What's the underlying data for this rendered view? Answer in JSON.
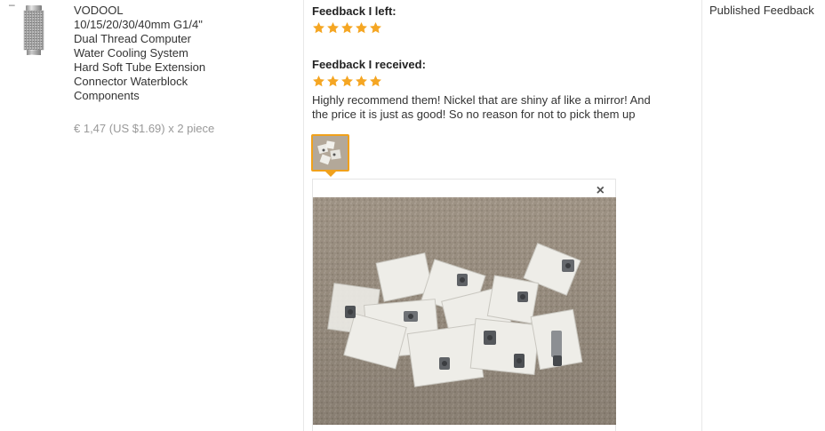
{
  "row": {
    "collapse_symbol": "–",
    "product": {
      "title_lines": [
        "VODOOL",
        "10/15/20/30/40mm G1/4\"",
        "Dual Thread Computer",
        "Water Cooling System",
        "Hard Soft Tube Extension",
        "Connector Waterblock",
        "Components"
      ],
      "price": "€ 1,47 (US $1.69) x 2 piece"
    },
    "feedback_left": {
      "heading": "Feedback I left:",
      "stars": 5
    },
    "feedback_received": {
      "heading": "Feedback I received:",
      "stars": 5,
      "text_lines": [
        "Highly recommend them! Nickel that are shiny af like a mirror! And",
        "the price it is just as good! So no reason for not to pick them up"
      ]
    },
    "viewer": {
      "close_symbol": "×"
    },
    "status": "Published Feedback"
  },
  "colors": {
    "star": "#f5a623",
    "thumb_border": "#f0a11c"
  }
}
